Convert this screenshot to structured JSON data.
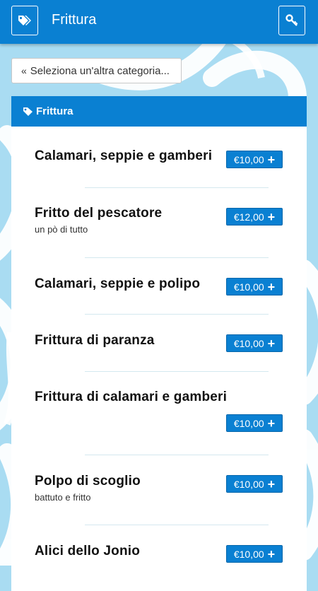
{
  "header": {
    "title": "Frittura",
    "left_icon": "tags-icon",
    "right_icon": "key-icon"
  },
  "back_button": {
    "label": "Seleziona un'altra categoria..."
  },
  "category": {
    "name": "Frittura"
  },
  "items": [
    {
      "name": "Calamari, seppie e gamberi",
      "description": "",
      "price": "€10,00"
    },
    {
      "name": "Fritto del pescatore",
      "description": "un pò di tutto",
      "price": "€12,00"
    },
    {
      "name": "Calamari, seppie e polipo",
      "description": "",
      "price": "€10,00"
    },
    {
      "name": "Frittura di paranza",
      "description": "",
      "price": "€10,00"
    },
    {
      "name": "Frittura di calamari e gamberi",
      "description": "",
      "price": "€10,00"
    },
    {
      "name": "Polpo di scoglio",
      "description": "battuto e fritto",
      "price": "€10,00"
    },
    {
      "name": "Alici dello Jonio",
      "description": "",
      "price": "€10,00"
    }
  ],
  "colors": {
    "accent": "#0a80d2",
    "background": "#a9dcf2"
  }
}
